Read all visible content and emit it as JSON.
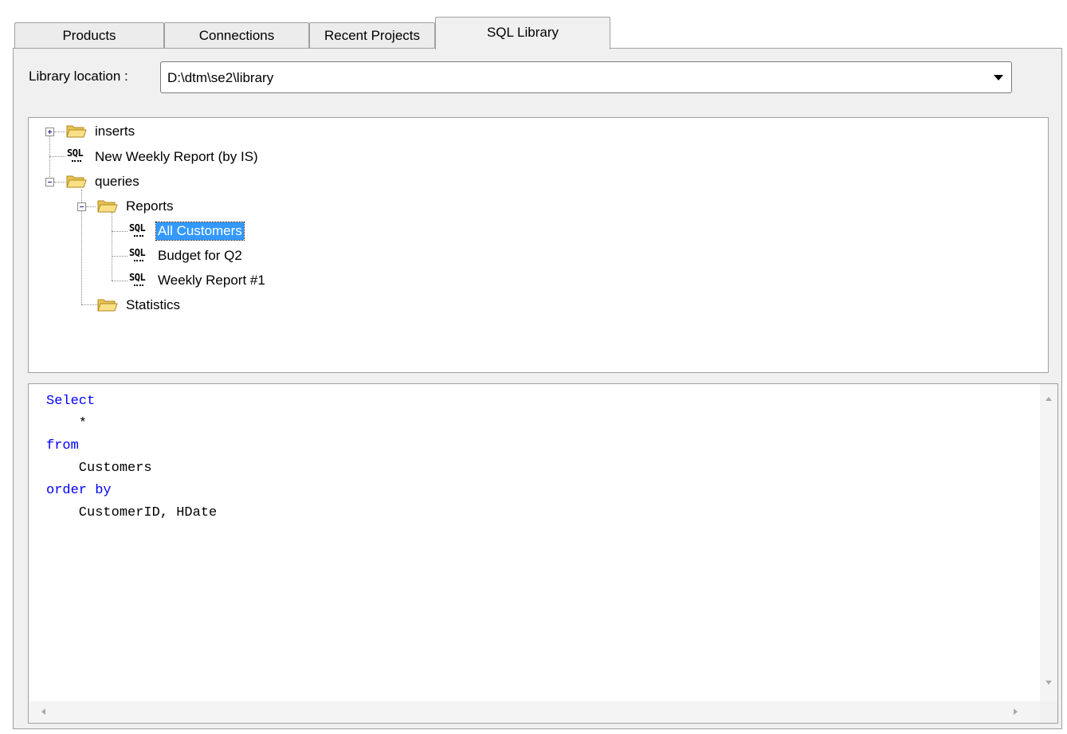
{
  "tabs": [
    {
      "label": "Products",
      "active": false
    },
    {
      "label": "Connections",
      "active": false
    },
    {
      "label": "Recent Projects",
      "active": false
    },
    {
      "label": "SQL Library",
      "active": true
    }
  ],
  "library": {
    "label": "Library location :",
    "value": "D:\\dtm\\se2\\library"
  },
  "tree": {
    "nodes": [
      {
        "label": "inserts",
        "type": "folder",
        "expanded": false
      },
      {
        "label": "New Weekly Report (by IS)",
        "type": "sql"
      },
      {
        "label": "queries",
        "type": "folder",
        "expanded": true
      },
      {
        "label": "Reports",
        "type": "folder",
        "expanded": true
      },
      {
        "label": "All Customers",
        "type": "sql",
        "selected": true
      },
      {
        "label": "Budget for Q2",
        "type": "sql"
      },
      {
        "label": "Weekly Report #1",
        "type": "sql"
      },
      {
        "label": "Statistics",
        "type": "folder"
      }
    ],
    "sql_icon_text": "SQL"
  },
  "editor": {
    "lines": [
      {
        "text": "Select",
        "keyword": true
      },
      {
        "text": "    *",
        "keyword": false
      },
      {
        "text": "from",
        "keyword": true
      },
      {
        "text": "    Customers",
        "keyword": false
      },
      {
        "text": "order by",
        "keyword": true
      },
      {
        "text": "    CustomerID, HDate",
        "keyword": false
      }
    ]
  },
  "colors": {
    "keyword": "#0000ff",
    "selection": "#3399ff",
    "panel": "#f0f0f0"
  },
  "icons": {
    "folder": "folder-open-icon",
    "sql": "sql-file-icon",
    "dropdown": "chevron-down-icon"
  }
}
